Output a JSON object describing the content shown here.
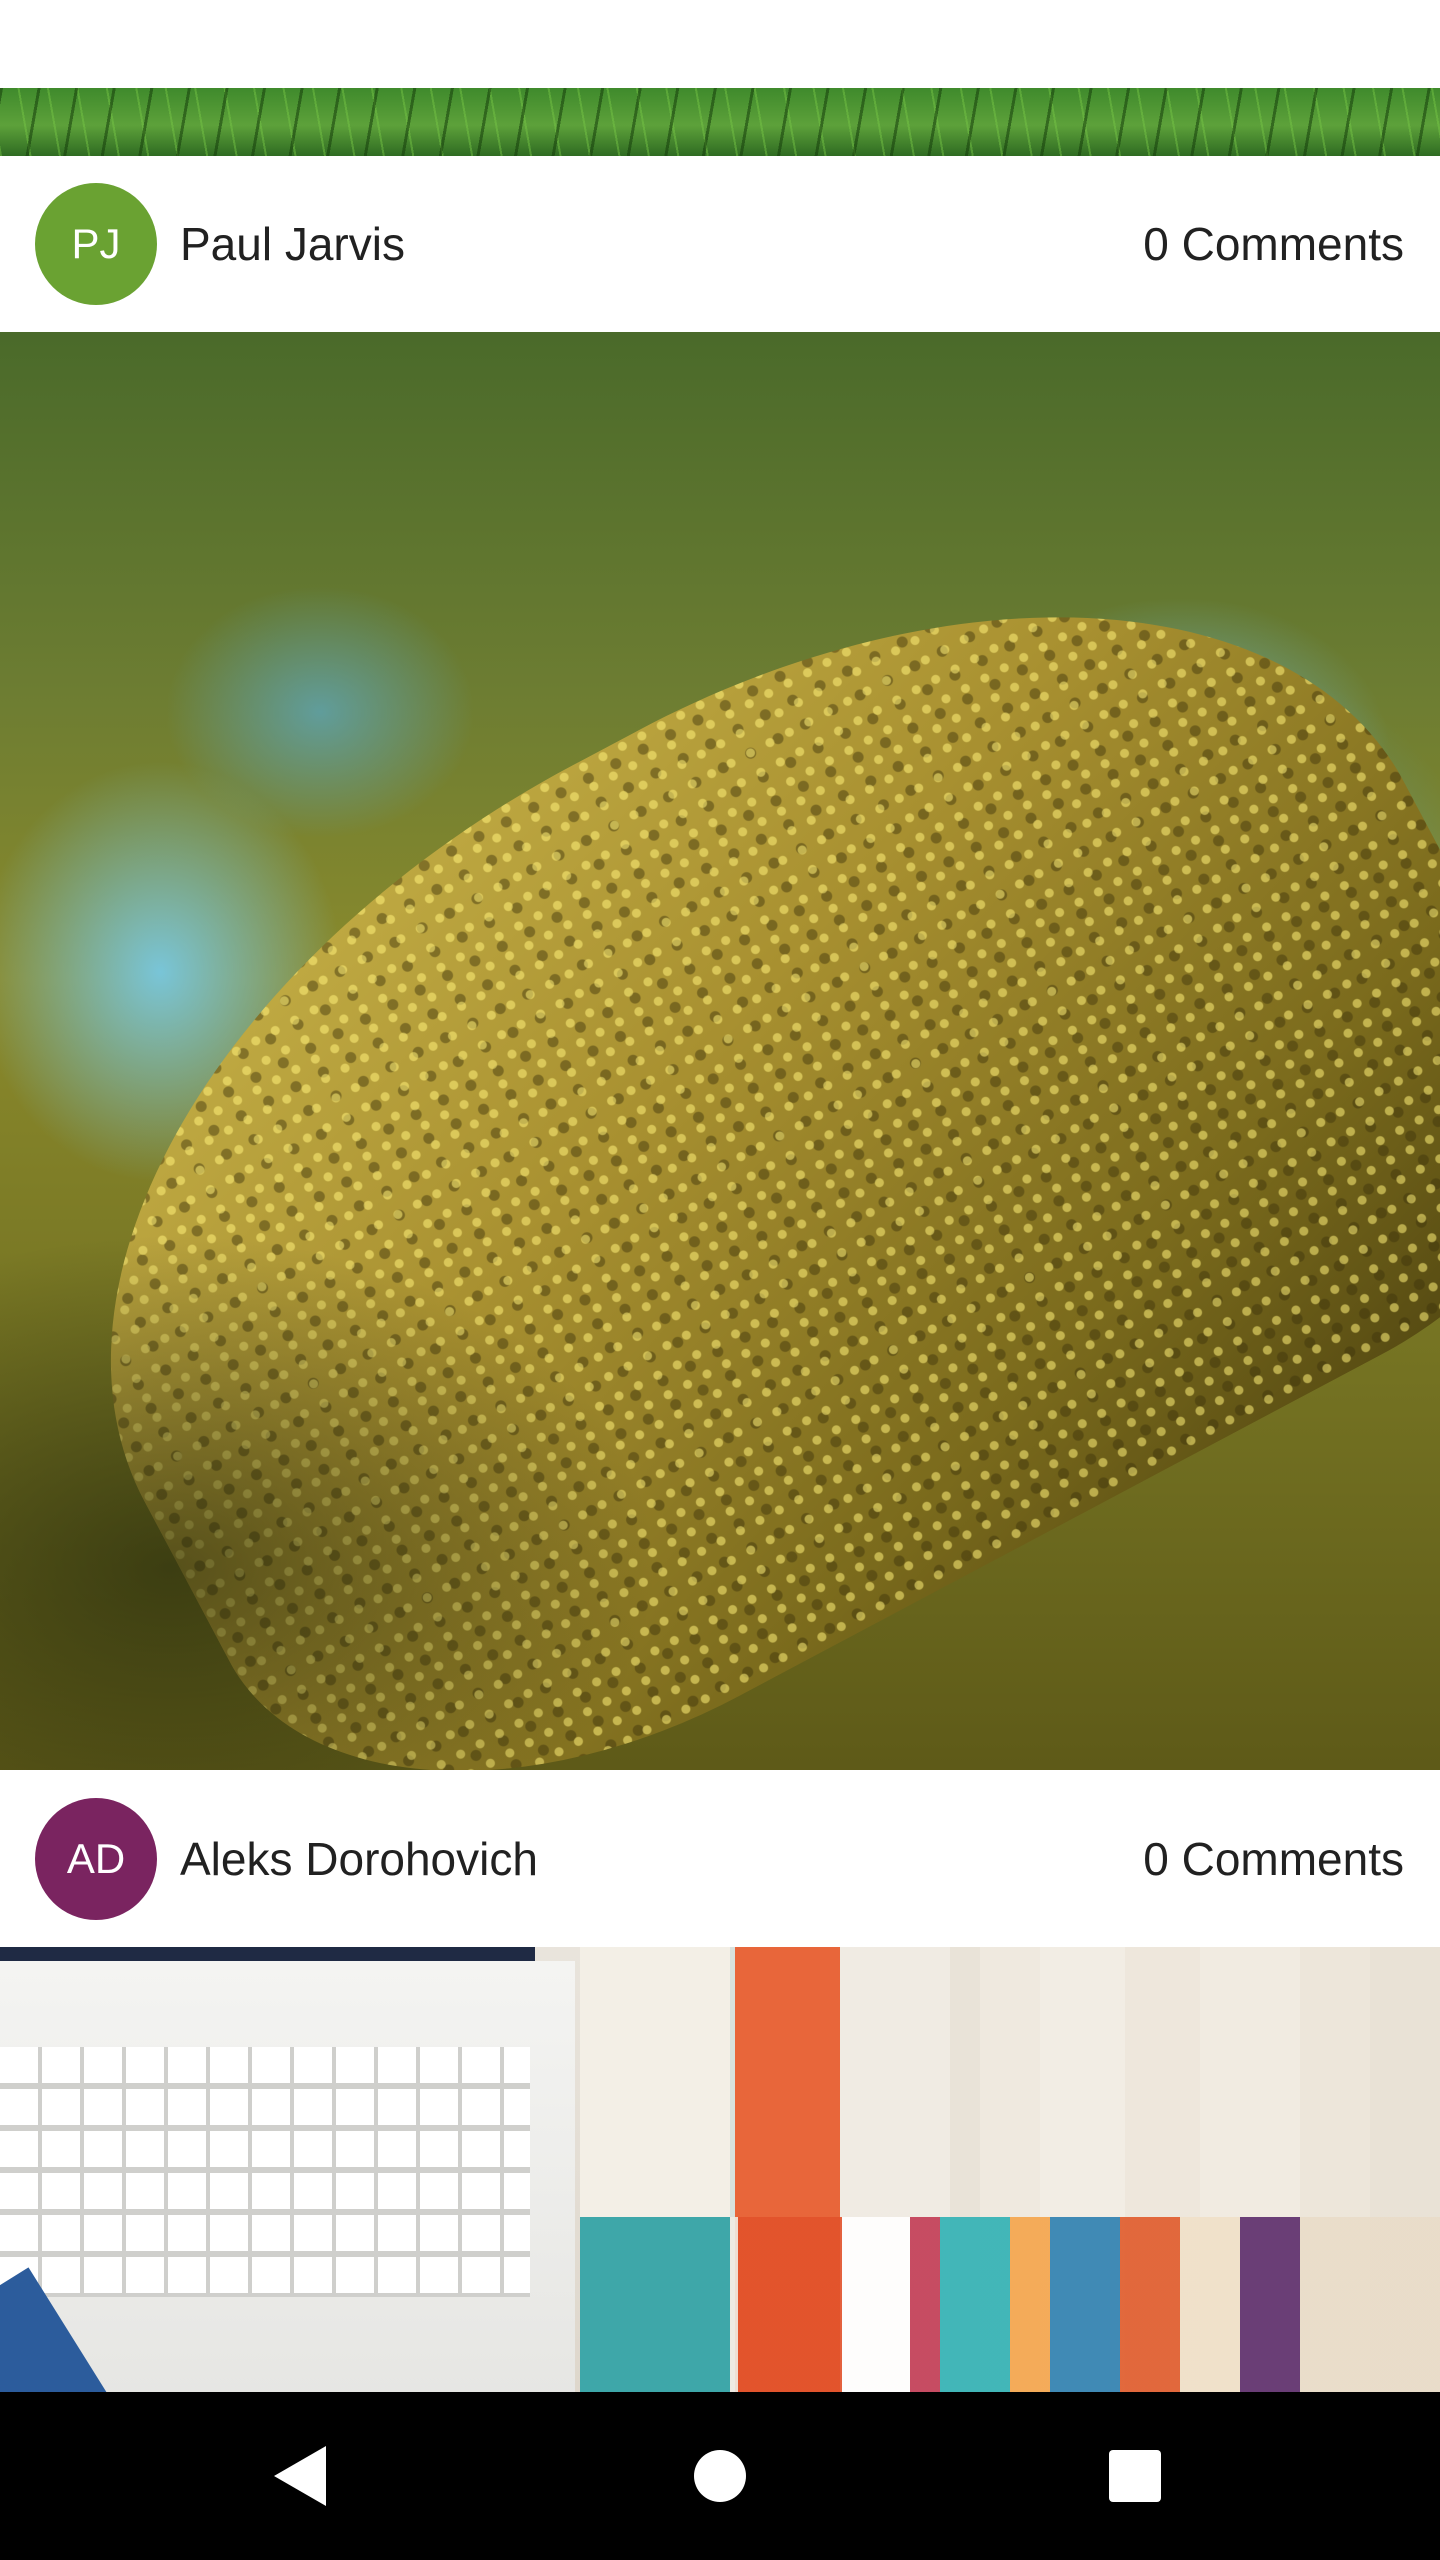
{
  "posts": [
    {
      "author": "Paul Jarvis",
      "initials": "PJ",
      "avatar_color": "#6aa232",
      "comments_label": "0 Comments",
      "photo": "moss-covered-tree"
    },
    {
      "author": "Aleks Dorohovich",
      "initials": "AD",
      "avatar_color": "#7a2460",
      "comments_label": "0 Comments",
      "photo": "laptop-and-books"
    }
  ],
  "top_photo": "grass",
  "nav_bar": {
    "back_icon": "back-triangle-icon",
    "home_icon": "home-circle-icon",
    "recents_icon": "recents-square-icon"
  }
}
